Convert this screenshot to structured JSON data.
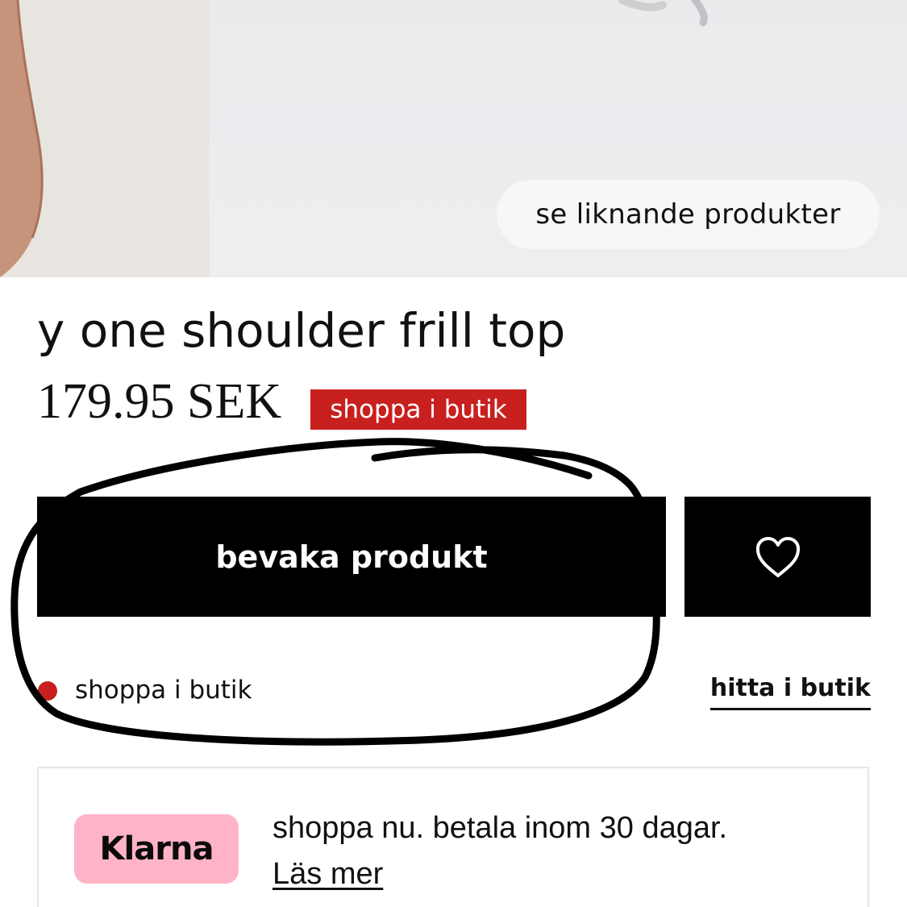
{
  "hero": {
    "similar_button_label": "se liknande produkter"
  },
  "product": {
    "title": "y one shoulder frill top",
    "price": "179.95 SEK",
    "badge": "shoppa i butik"
  },
  "actions": {
    "watch_label": "bevaka produkt",
    "favorite_icon": "heart-icon"
  },
  "stock": {
    "status_label": "shoppa i butik",
    "status_color": "#c8201f",
    "find_in_store_label": "hitta i butik"
  },
  "klarna": {
    "logo_text": "Klarna",
    "logo_color": "#ffb3c7",
    "message": "shoppa nu. betala inom 30 dagar.",
    "read_more_label": "Läs mer"
  },
  "colors": {
    "accent_red": "#c8201f",
    "button_black": "#000000"
  }
}
